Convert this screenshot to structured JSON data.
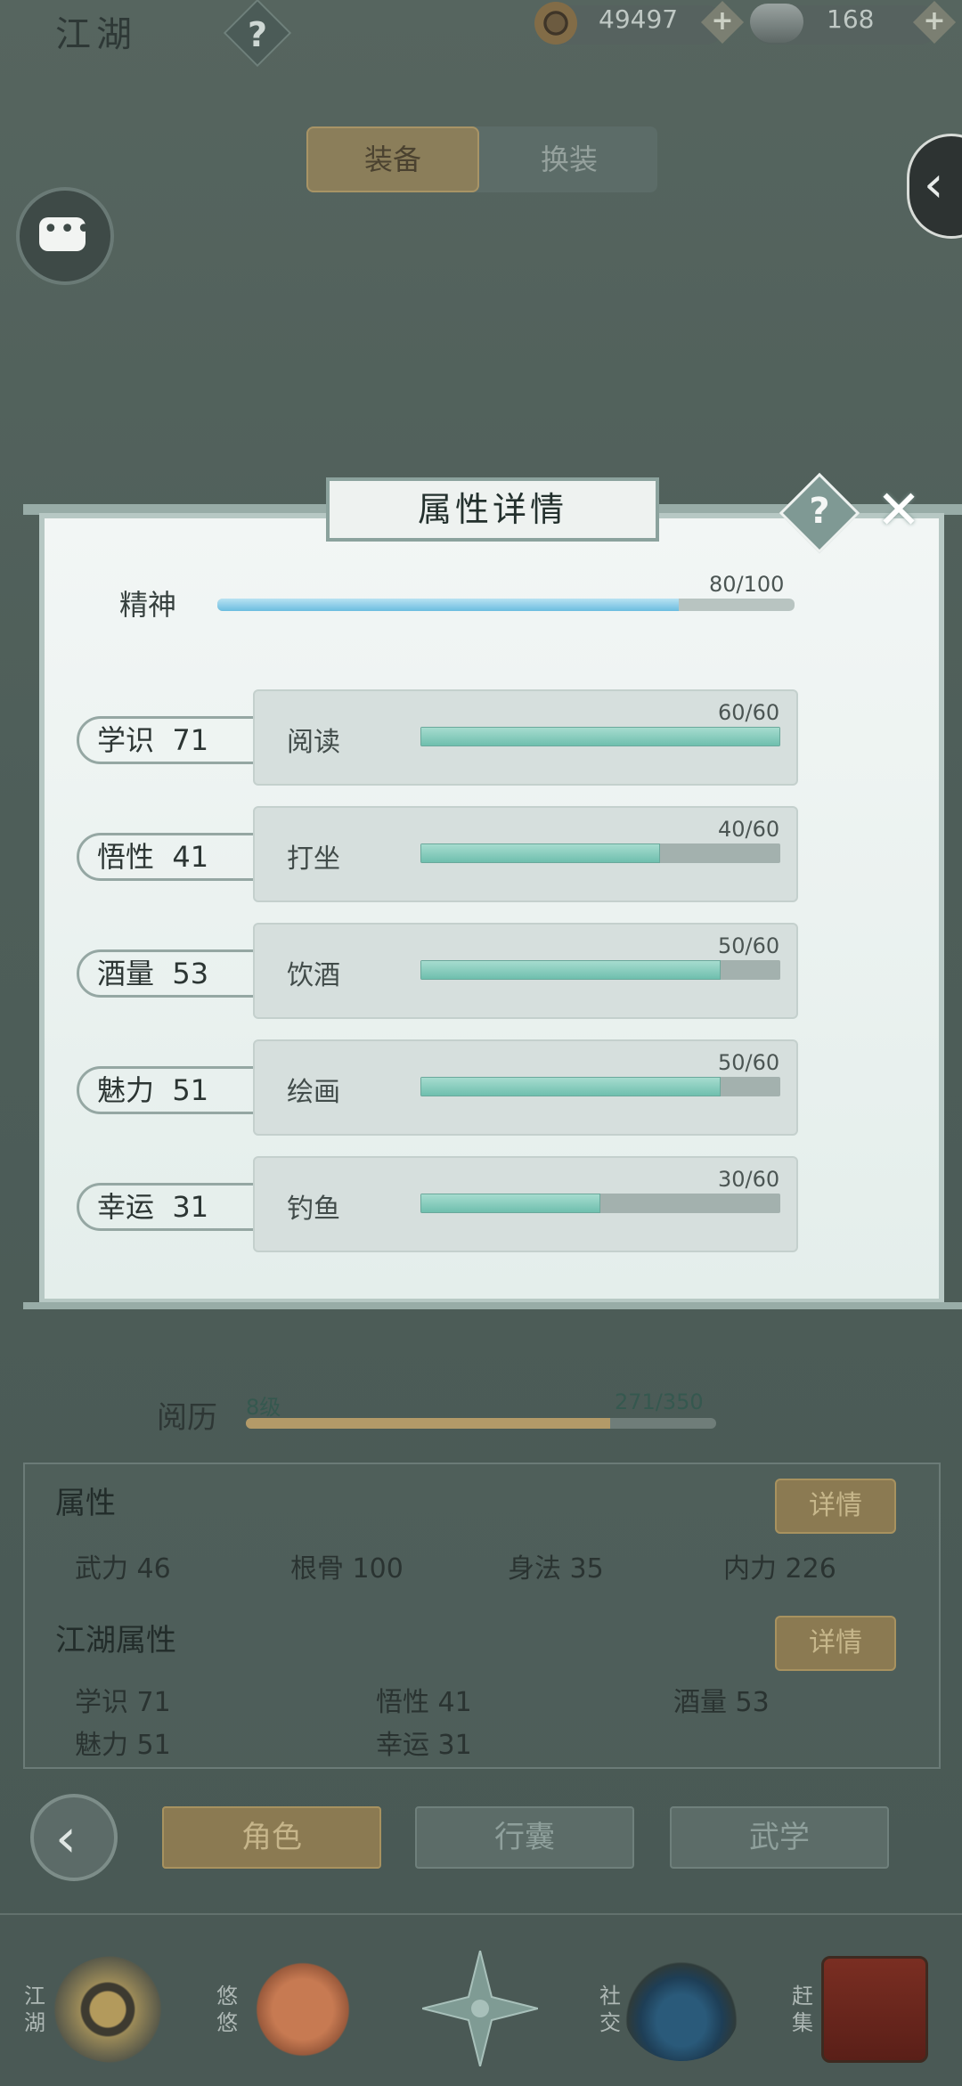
{
  "header": {
    "title": "江湖",
    "help": "?",
    "coins": "49497",
    "ingots": "168",
    "plus": "+"
  },
  "top_tabs": {
    "active": "装备",
    "inactive": "换装"
  },
  "modal": {
    "title": "属性详情",
    "help": "?",
    "close": "✕",
    "spirit": {
      "label": "精神",
      "value_text": "80/100",
      "value": 80,
      "max": 100
    },
    "attributes": [
      {
        "name": "学识",
        "value": "71",
        "activity": "阅读",
        "progress_text": "60/60",
        "progress": 1.0
      },
      {
        "name": "悟性",
        "value": "41",
        "activity": "打坐",
        "progress_text": "40/60",
        "progress": 0.667
      },
      {
        "name": "酒量",
        "value": "53",
        "activity": "饮酒",
        "progress_text": "50/60",
        "progress": 0.833
      },
      {
        "name": "魅力",
        "value": "51",
        "activity": "绘画",
        "progress_text": "50/60",
        "progress": 0.833
      },
      {
        "name": "幸运",
        "value": "31",
        "activity": "钓鱼",
        "progress_text": "30/60",
        "progress": 0.5
      }
    ]
  },
  "experience": {
    "label": "阅历",
    "level": "8级",
    "value_text": "271/350",
    "progress": 0.774
  },
  "attributes_section": {
    "title": "属性",
    "detail_button": "详情",
    "stats": [
      {
        "name": "武力",
        "value": "46"
      },
      {
        "name": "根骨",
        "value": "100"
      },
      {
        "name": "身法",
        "value": "35"
      },
      {
        "name": "内力",
        "value": "226"
      }
    ]
  },
  "jianghu_section": {
    "title": "江湖属性",
    "detail_button": "详情",
    "stats": [
      {
        "name": "学识",
        "value": "71"
      },
      {
        "name": "悟性",
        "value": "41"
      },
      {
        "name": "酒量",
        "value": "53"
      },
      {
        "name": "魅力",
        "value": "51"
      },
      {
        "name": "幸运",
        "value": "31"
      }
    ]
  },
  "bottom_tabs": {
    "role": "角色",
    "bag": "行囊",
    "martial": "武学"
  },
  "nav": {
    "jianghu": "江湖",
    "youyou": "悠悠",
    "social": "社交",
    "market": "赶集"
  },
  "colors": {
    "accent_gold": "#8b7a52",
    "bar_teal": "#7fc7b6",
    "bar_blue": "#7fc4e0",
    "xp_bar": "#b39a68"
  }
}
